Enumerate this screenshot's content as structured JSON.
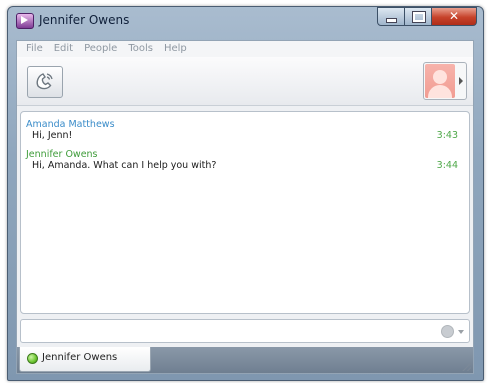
{
  "window": {
    "title": "Jennifer Owens"
  },
  "menu": [
    "File",
    "Edit",
    "People",
    "Tools",
    "Help"
  ],
  "toolbar": {
    "call_icon": "phone-icon",
    "avatar_icon": "contact-avatar-icon"
  },
  "messages": [
    {
      "sender": "Amanda Matthews",
      "text": "Hi, Jenn!",
      "time": "3:43"
    },
    {
      "sender": "Jennifer Owens",
      "text": "Hi, Amanda. What can I help you with?",
      "time": "3:44"
    }
  ],
  "compose": {
    "value": "",
    "emoticon_icon": "smiley-icon"
  },
  "contact_tab": {
    "name": "Jennifer Owens",
    "status": "online"
  },
  "colors": {
    "sender_a": "#3a8cc9",
    "sender_b": "#3f9c3a",
    "timestamp": "#4ea849",
    "status_online": "#6cc530"
  }
}
